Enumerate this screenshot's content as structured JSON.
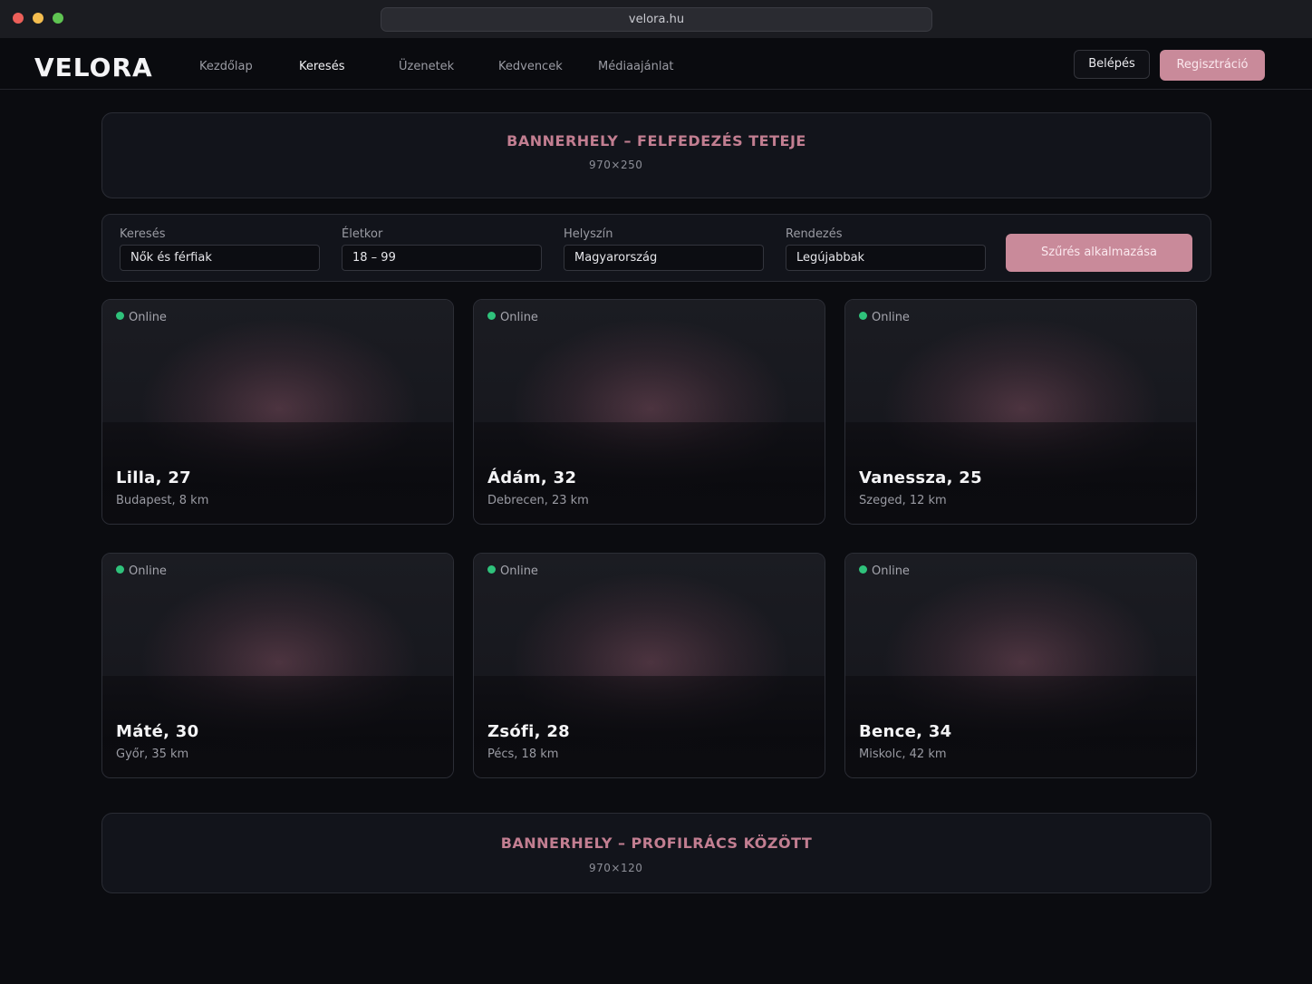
{
  "browser": {
    "url": "velora.hu"
  },
  "navbar": {
    "brand": "VELORA",
    "links": [
      {
        "label": "Kezdőlap"
      },
      {
        "label": "Keresés",
        "active": true
      },
      {
        "label": "Üzenetek"
      },
      {
        "label": "Kedvencek"
      },
      {
        "label": "Médiaajánlat"
      }
    ],
    "login_label": "Belépés",
    "register_label": "Regisztráció"
  },
  "banner_top": {
    "title": "BANNERHELY – FELFEDEZÉS TETEJE",
    "size": "970×250"
  },
  "filters": {
    "search": {
      "label": "Keresés",
      "value": "Nők és férfiak"
    },
    "age": {
      "label": "Életkor",
      "value": "18 – 99"
    },
    "location": {
      "label": "Helyszín",
      "value": "Magyarország"
    },
    "sort": {
      "label": "Rendezés",
      "value": "Legújabbak"
    },
    "apply_label": "Szűrés alkalmazása"
  },
  "profiles": [
    {
      "status": "Online",
      "name": "Lilla, 27",
      "location": "Budapest, 8 km"
    },
    {
      "status": "Online",
      "name": "Ádám, 32",
      "location": "Debrecen, 23 km"
    },
    {
      "status": "Online",
      "name": "Vanessza, 25",
      "location": "Szeged, 12 km"
    },
    {
      "status": "Online",
      "name": "Máté, 30",
      "location": "Győr, 35 km"
    },
    {
      "status": "Online",
      "name": "Zsófi, 28",
      "location": "Pécs, 18 km"
    },
    {
      "status": "Online",
      "name": "Bence, 34",
      "location": "Miskolc, 42 km"
    }
  ],
  "banner_mid": {
    "title": "BANNERHELY – PROFILRÁCS KÖZÖTT",
    "size": "970×120"
  },
  "colors": {
    "accent": "#c98a9a",
    "banner_text": "#c27e91",
    "online": "#2fc27b",
    "background": "#0b0c10"
  }
}
